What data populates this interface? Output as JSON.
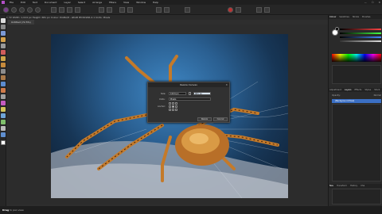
{
  "menu": {
    "items": [
      "File",
      "Edit",
      "Text",
      "Document",
      "Layer",
      "Select",
      "Arrange",
      "Filters",
      "View",
      "Window",
      "Help"
    ],
    "window_controls": [
      "—",
      "☐",
      "✕"
    ]
  },
  "context_bar": {
    "text": "DPI: 72    Width: 1,024 px  Height: 681 px    Colour: RGBA/8 - sRGB IEC61966-2.1    Units: Pixels"
  },
  "document_tab": {
    "label": "Untitled (72.5%)"
  },
  "dialog": {
    "title": "Resize Canvas",
    "close": "✕",
    "size_label": "Size:",
    "size_width": "1024 px",
    "size_height": "681 px",
    "units_label": "Units:",
    "units_value": "Pixels",
    "anchor_label": "Anchor:",
    "resize_button": "Resize",
    "cancel_button": "Cancel"
  },
  "right_panel": {
    "top_tabs": [
      "Colour",
      "Swatches",
      "Stroke",
      "Brushes"
    ],
    "mid_tabs": [
      "Adjustment",
      "Layers",
      "Effects",
      "Styles",
      "Stock"
    ],
    "layers_opacity_label": "Opacity:",
    "layers_blend_label": "Normal",
    "layer_name": "(Background Pixel)",
    "bottom_tabs": [
      "Nav",
      "Transform",
      "History",
      "Cha"
    ]
  },
  "status": {
    "tool_name": "Drag",
    "hint": " to pan view."
  },
  "colors": {
    "accent": "#3b6fc4",
    "app_bg": "#2e2e2e",
    "logo": "#b34fc7"
  }
}
